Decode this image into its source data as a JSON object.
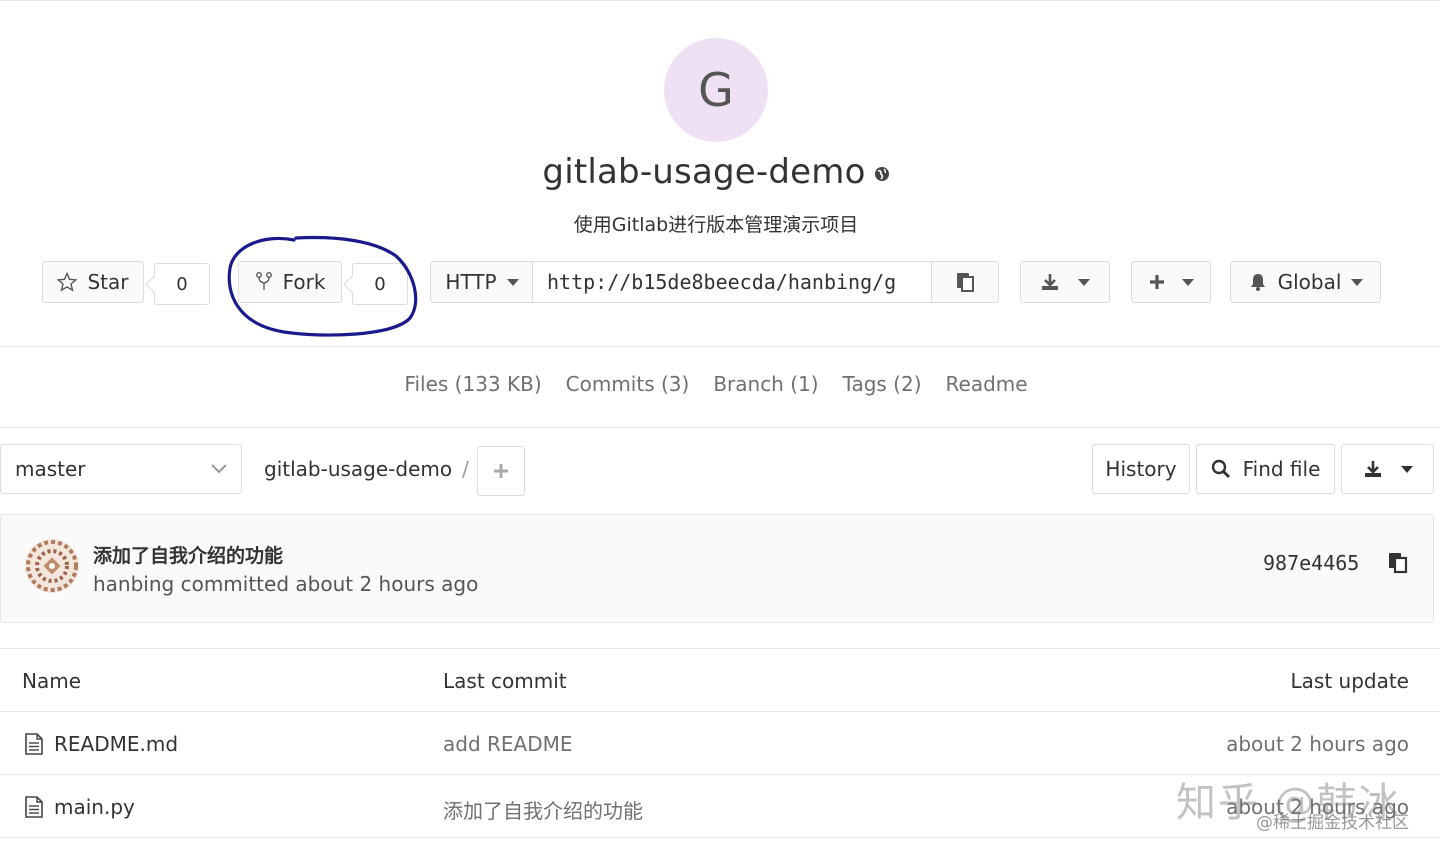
{
  "project": {
    "avatar_letter": "G",
    "name": "gitlab-usage-demo",
    "description": "使用Gitlab进行版本管理演示项目"
  },
  "controls": {
    "star_label": "Star",
    "star_count": "0",
    "fork_label": "Fork",
    "fork_count": "0",
    "protocol": "HTTP",
    "clone_url": "http://b15de8beecda/hanbing/g",
    "notification_label": "Global"
  },
  "nav": {
    "files": "Files (133 KB)",
    "commits": "Commits (3)",
    "branch": "Branch (1)",
    "tags": "Tags (2)",
    "readme": "Readme"
  },
  "tree": {
    "branch": "master",
    "breadcrumb": "gitlab-usage-demo",
    "breadcrumb_sep": "/",
    "history": "History",
    "find_file": "Find file"
  },
  "commit": {
    "title": "添加了自我介绍的功能",
    "meta": "hanbing committed about 2 hours ago",
    "sha": "987e4465"
  },
  "table": {
    "headers": {
      "name": "Name",
      "last_commit": "Last commit",
      "last_update": "Last update"
    },
    "rows": [
      {
        "name": "README.md",
        "commit": "add README",
        "updated": "about 2 hours ago"
      },
      {
        "name": "main.py",
        "commit": "添加了自我介绍的功能",
        "updated": "about 2 hours ago"
      }
    ]
  },
  "watermark": {
    "line1": "知乎 @韩冰",
    "line2": "@稀土掘金技术社区"
  },
  "colors": {
    "avatar_bg": "#eee1f3",
    "annotation_circle": "#1a1a8c",
    "border": "#dcdcdc",
    "muted_text": "#707070"
  }
}
